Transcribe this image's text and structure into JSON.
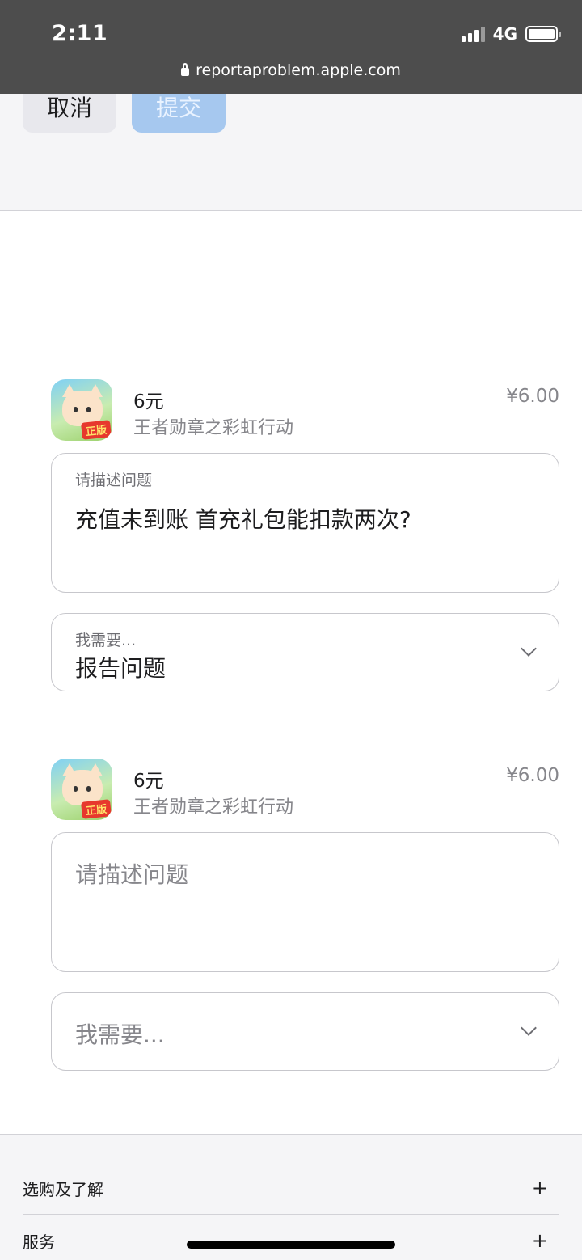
{
  "status": {
    "time": "2:11",
    "network": "4G"
  },
  "browser": {
    "url": "reportaproblem.apple.com"
  },
  "toolbar": {
    "cancel_label": "取消",
    "submit_label": "提交"
  },
  "items": [
    {
      "title": "6元",
      "subtitle": "王者勋章之彩虹行动",
      "price": "¥6.00",
      "icon_badge": "正版",
      "description_label": "请描述问题",
      "description_value": "充值未到账 首充礼包能扣款两次?",
      "need_label": "我需要...",
      "need_value": "报告问题"
    },
    {
      "title": "6元",
      "subtitle": "王者勋章之彩虹行动",
      "price": "¥6.00",
      "icon_badge": "正版",
      "description_placeholder": "请描述问题",
      "need_placeholder": "我需要..."
    }
  ],
  "footer": {
    "sections": [
      {
        "label": "选购及了解",
        "toggle": "+"
      },
      {
        "label": "服务",
        "toggle": "+"
      }
    ]
  }
}
